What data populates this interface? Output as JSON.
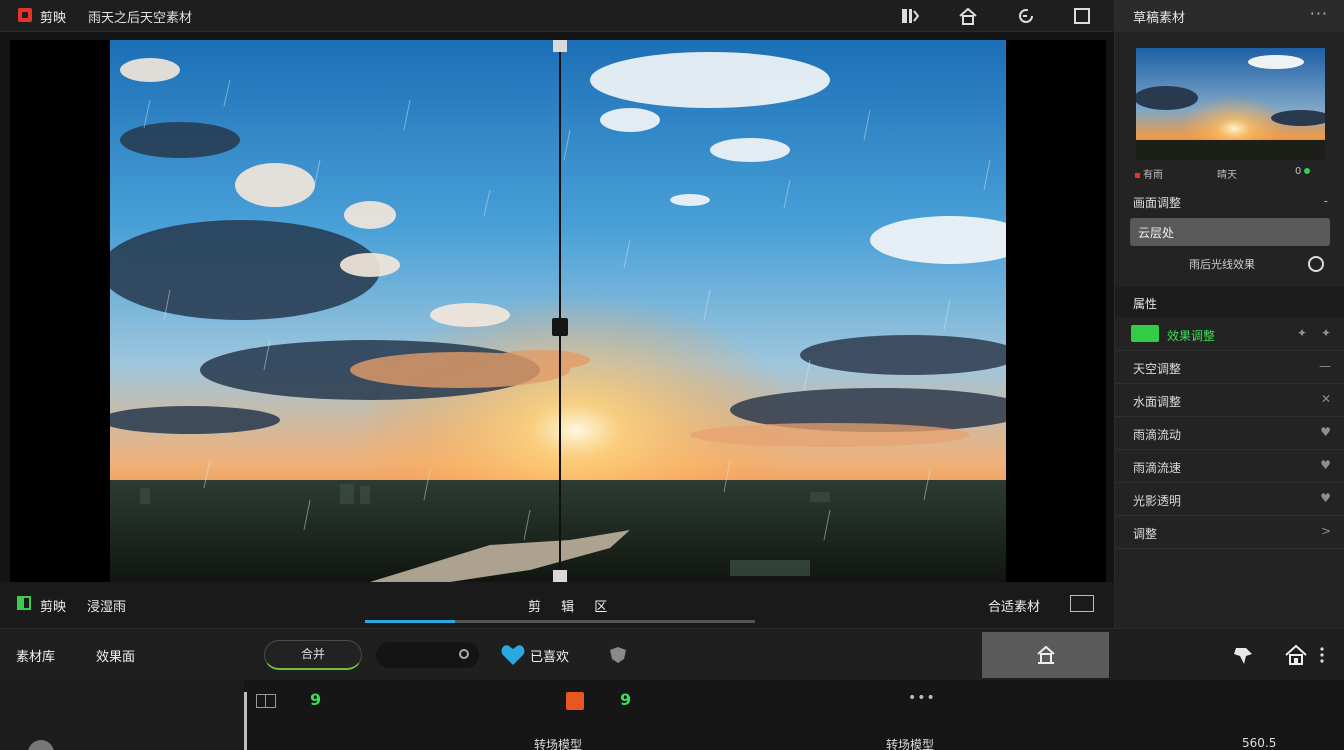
{
  "app": {
    "title": "剪映",
    "project_name": "雨天之后天空素材"
  },
  "topbar": {
    "icons": [
      "clip-icon",
      "home-icon",
      "refresh-icon",
      "square-icon"
    ]
  },
  "right_panel": {
    "title": "草稿素材",
    "more": "···",
    "thumb_meta": {
      "left": "有雨",
      "middle": "晴天",
      "right": "0"
    },
    "section1": {
      "label": "画面调整",
      "caret": "-"
    },
    "select_value": "云层处",
    "hint": "雨后光线效果",
    "section2": "属性",
    "rows": [
      {
        "label": "效果调整",
        "control": "",
        "highlighted": true
      },
      {
        "label": "天空调整",
        "control": "—"
      },
      {
        "label": "水面调整",
        "control": "✕"
      },
      {
        "label": "雨滴流动",
        "control": "♥"
      },
      {
        "label": "雨滴流速",
        "control": "♥"
      },
      {
        "label": "光影透明",
        "control": "♥"
      },
      {
        "label": "调整",
        "control": ">"
      }
    ]
  },
  "viewer": {
    "left_label_1": "剪映",
    "left_label_2": "浸湿雨",
    "center_label": "剪 辑 区",
    "right_label": "合适素材",
    "scrub_progress": 0.23
  },
  "toolbar": {
    "item1": "素材库",
    "item2": "效果面",
    "pill_label": "合并",
    "heart_label": "已喜欢",
    "accent_green": "#3ccb4b",
    "accent_blue": "#29a9e0"
  },
  "bottom": {
    "num1": "9",
    "num2": "9",
    "dots": "•••",
    "label_left": "转场模型",
    "label_mid": "转场模型",
    "label_right": "560.5"
  }
}
